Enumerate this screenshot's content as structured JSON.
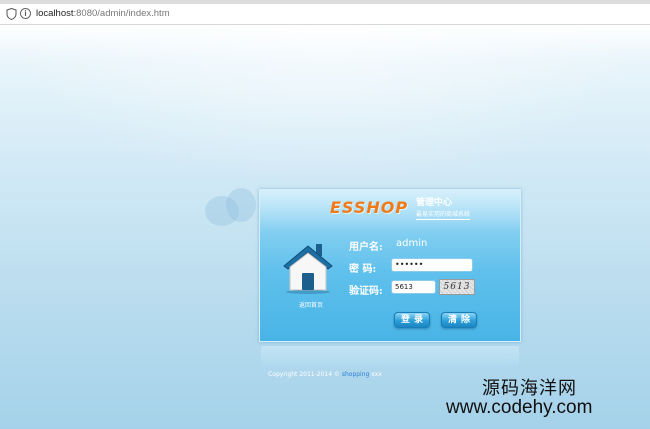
{
  "browser": {
    "url_host": "localhost",
    "url_path": ":8080/admin/index.htm",
    "info_glyph": "i"
  },
  "login_panel": {
    "logo_text": "ESSHOP",
    "title": "管理中心",
    "subtitle": "最易实用的商城系统",
    "back_home_label": "返回首页",
    "username_label": "用户名:",
    "username_value": "admin",
    "password_label": "密    码:",
    "password_value": "••••••",
    "captcha_label": "验证码:",
    "captcha_input_value": "5613",
    "captcha_image_text": "5613",
    "login_button": "登录",
    "clear_button": "清除"
  },
  "footer": {
    "copyright_prefix": "Copyright 2011-2014 © ",
    "copyright_brand": "shopping",
    "copyright_suffix": " xxx"
  },
  "watermark": {
    "line1": "源码海洋网",
    "line2": "www.codehy.com"
  },
  "colors": {
    "panel_top": "#a6ddf6",
    "panel_bottom": "#48b4e6",
    "logo": "#f07a18",
    "button": "#2b9fd8"
  }
}
